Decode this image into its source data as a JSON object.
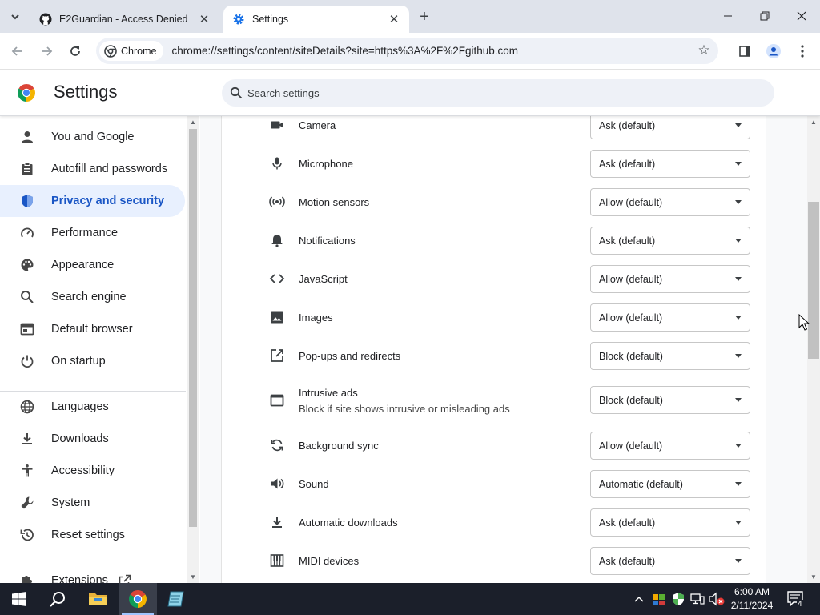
{
  "browser": {
    "tabs": [
      {
        "title": "E2Guardian - Access Denied",
        "favicon": "github-icon",
        "active": false
      },
      {
        "title": "Settings",
        "favicon": "gear-icon",
        "active": true
      }
    ],
    "chip_label": "Chrome",
    "url": "chrome://settings/content/siteDetails?site=https%3A%2F%2Fgithub.com"
  },
  "settings": {
    "title": "Settings",
    "search_placeholder": "Search settings"
  },
  "sidebar": {
    "items": [
      {
        "label": "You and Google",
        "icon": "person-icon"
      },
      {
        "label": "Autofill and passwords",
        "icon": "clipboard-icon"
      },
      {
        "label": "Privacy and security",
        "icon": "shield-icon",
        "selected": true
      },
      {
        "label": "Performance",
        "icon": "speedometer-icon"
      },
      {
        "label": "Appearance",
        "icon": "palette-icon"
      },
      {
        "label": "Search engine",
        "icon": "search-icon"
      },
      {
        "label": "Default browser",
        "icon": "browser-icon"
      },
      {
        "label": "On startup",
        "icon": "power-icon"
      },
      {
        "label": "Languages",
        "icon": "globe-icon"
      },
      {
        "label": "Downloads",
        "icon": "download-icon"
      },
      {
        "label": "Accessibility",
        "icon": "accessibility-icon"
      },
      {
        "label": "System",
        "icon": "wrench-icon"
      },
      {
        "label": "Reset settings",
        "icon": "reset-icon"
      },
      {
        "label": "Extensions",
        "icon": "puzzle-icon"
      }
    ]
  },
  "permissions": [
    {
      "label": "Camera",
      "value": "Ask (default)",
      "icon": "camera-icon"
    },
    {
      "label": "Microphone",
      "value": "Ask (default)",
      "icon": "microphone-icon"
    },
    {
      "label": "Motion sensors",
      "value": "Allow (default)",
      "icon": "motion-sensor-icon"
    },
    {
      "label": "Notifications",
      "value": "Ask (default)",
      "icon": "bell-icon"
    },
    {
      "label": "JavaScript",
      "value": "Allow (default)",
      "icon": "code-icon"
    },
    {
      "label": "Images",
      "value": "Allow (default)",
      "icon": "image-icon"
    },
    {
      "label": "Pop-ups and redirects",
      "value": "Block (default)",
      "icon": "popup-icon"
    },
    {
      "label": "Intrusive ads",
      "sublabel": "Block if site shows intrusive or misleading ads",
      "value": "Block (default)",
      "icon": "ads-icon"
    },
    {
      "label": "Background sync",
      "value": "Allow (default)",
      "icon": "sync-icon"
    },
    {
      "label": "Sound",
      "value": "Automatic (default)",
      "icon": "speaker-icon"
    },
    {
      "label": "Automatic downloads",
      "value": "Ask (default)",
      "icon": "download-icon"
    },
    {
      "label": "MIDI devices",
      "value": "Ask (default)",
      "icon": "piano-icon"
    }
  ],
  "taskbar": {
    "time": "6:00 AM",
    "date": "2/11/2024",
    "notification_count": "4"
  }
}
